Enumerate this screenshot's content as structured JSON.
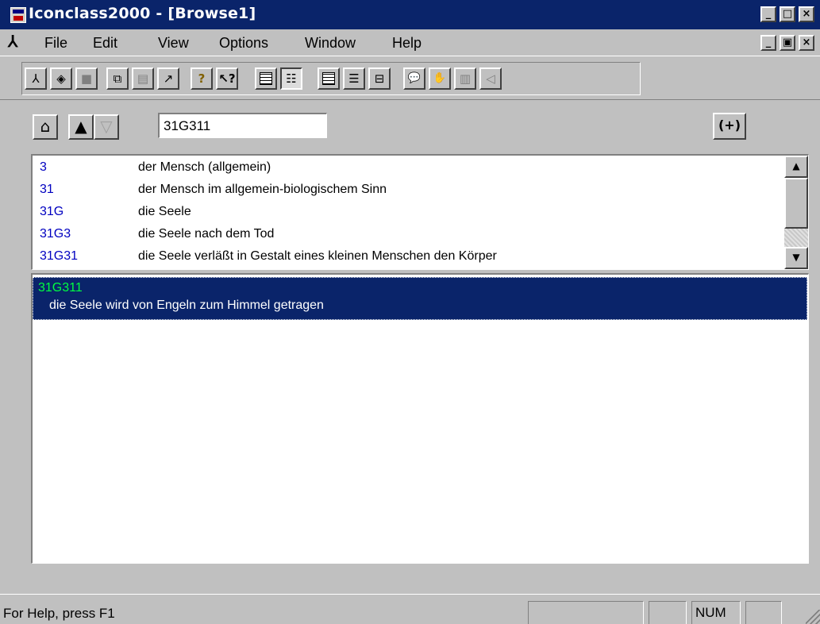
{
  "window": {
    "title": "Iconclass2000 - [Browse1]",
    "caption_buttons": {
      "minimize": "_",
      "restore": "□",
      "close": "×"
    },
    "doc_caption_buttons": {
      "minimize": "_",
      "restore": "▣",
      "close": "×"
    }
  },
  "menu": {
    "items": [
      {
        "label": "File"
      },
      {
        "label": "Edit"
      },
      {
        "label": "View"
      },
      {
        "label": "Options"
      },
      {
        "label": "Window"
      },
      {
        "label": "Help"
      }
    ]
  },
  "toolbar": {
    "buttons": [
      {
        "icon": "iconclass-logo-icon",
        "glyph": "⅄",
        "state": "normal"
      },
      {
        "icon": "document-view-icon",
        "glyph": "◈",
        "state": "normal"
      },
      {
        "icon": "document-disabled-icon",
        "glyph": "■",
        "state": "disabled"
      },
      {
        "icon": "copy-icon",
        "glyph": "⧉",
        "state": "normal"
      },
      {
        "icon": "paste-icon",
        "glyph": "▤",
        "state": "disabled"
      },
      {
        "icon": "export-icon",
        "glyph": "↗",
        "state": "normal"
      },
      {
        "icon": "help-icon",
        "glyph": "?",
        "state": "normal"
      },
      {
        "icon": "context-help-icon",
        "glyph": "↖?",
        "state": "normal"
      },
      {
        "icon": "grid-view-icon",
        "glyph": "",
        "state": "normal"
      },
      {
        "icon": "list-view-icon",
        "glyph": "☷",
        "state": "pressed"
      },
      {
        "icon": "details-view-icon",
        "glyph": "",
        "state": "normal"
      },
      {
        "icon": "split-view-icon",
        "glyph": "☰",
        "state": "normal"
      },
      {
        "icon": "tree-view-icon",
        "glyph": "⊟",
        "state": "normal"
      },
      {
        "icon": "speech-icon",
        "glyph": "💬",
        "state": "normal"
      },
      {
        "icon": "hand-icon",
        "glyph": "✋",
        "state": "normal"
      },
      {
        "icon": "book-disabled-icon",
        "glyph": "▥",
        "state": "disabled"
      },
      {
        "icon": "audio-disabled-icon",
        "glyph": "◁",
        "state": "disabled"
      }
    ]
  },
  "navigation": {
    "home_glyph": "⌂",
    "up_glyph": "▲",
    "down_glyph": "▽",
    "code_value": "31G311",
    "expand_label": "(+)"
  },
  "hierarchy": {
    "rows": [
      {
        "code": "3",
        "description": "der Mensch (allgemein)"
      },
      {
        "code": "31",
        "description": "der Mensch im allgemein-biologischem Sinn"
      },
      {
        "code": "31G",
        "description": "die Seele"
      },
      {
        "code": "31G3",
        "description": "die Seele nach dem Tod"
      },
      {
        "code": "31G31",
        "description": "die Seele verläßt in Gestalt eines kleinen Menschen den Körper"
      }
    ],
    "scroll_up": "▲",
    "scroll_down": "▼"
  },
  "detail": {
    "code": "31G311",
    "description": "die Seele wird von Engeln zum Himmel getragen"
  },
  "status": {
    "help_text": "For Help, press F1",
    "num_indicator": "NUM"
  },
  "colors": {
    "title_bar": "#0a246a",
    "code_link": "#0000c0",
    "selected_code": "#00ff40",
    "face": "#c0c0c0"
  }
}
